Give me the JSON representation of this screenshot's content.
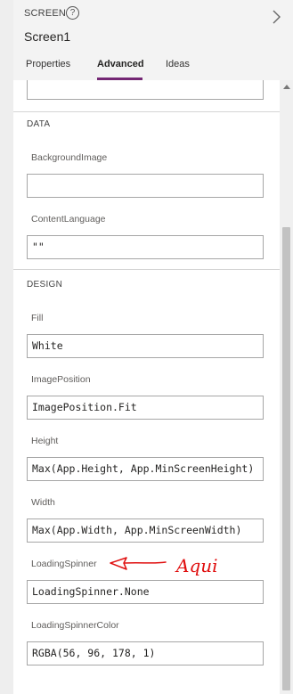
{
  "header": {
    "section_label": "SCREEN",
    "screen_name": "Screen1",
    "help_icon_glyph": "?",
    "tabs": [
      {
        "label": "Properties",
        "active": false
      },
      {
        "label": "Advanced",
        "active": true
      },
      {
        "label": "Ideas",
        "active": false
      }
    ]
  },
  "sections": {
    "data": {
      "title": "DATA",
      "background_image": {
        "label": "BackgroundImage",
        "value": ""
      },
      "content_language": {
        "label": "ContentLanguage",
        "value": "\"\""
      }
    },
    "design": {
      "title": "DESIGN",
      "fill": {
        "label": "Fill",
        "value": "White"
      },
      "image_position": {
        "label": "ImagePosition",
        "value": "ImagePosition.Fit"
      },
      "height": {
        "label": "Height",
        "value": "Max(App.Height, App.MinScreenHeight)"
      },
      "width": {
        "label": "Width",
        "value": "Max(App.Width, App.MinScreenWidth)"
      },
      "loading_spinner": {
        "label": "LoadingSpinner",
        "value": "LoadingSpinner.None"
      },
      "loading_spinner_color": {
        "label": "LoadingSpinnerColor",
        "value": "RGBA(56, 96, 178, 1)"
      }
    }
  },
  "annotation": {
    "text": "Aqui",
    "color": "#e01010"
  },
  "colors": {
    "accent": "#742774",
    "header_bg": "#f3f3f3"
  }
}
